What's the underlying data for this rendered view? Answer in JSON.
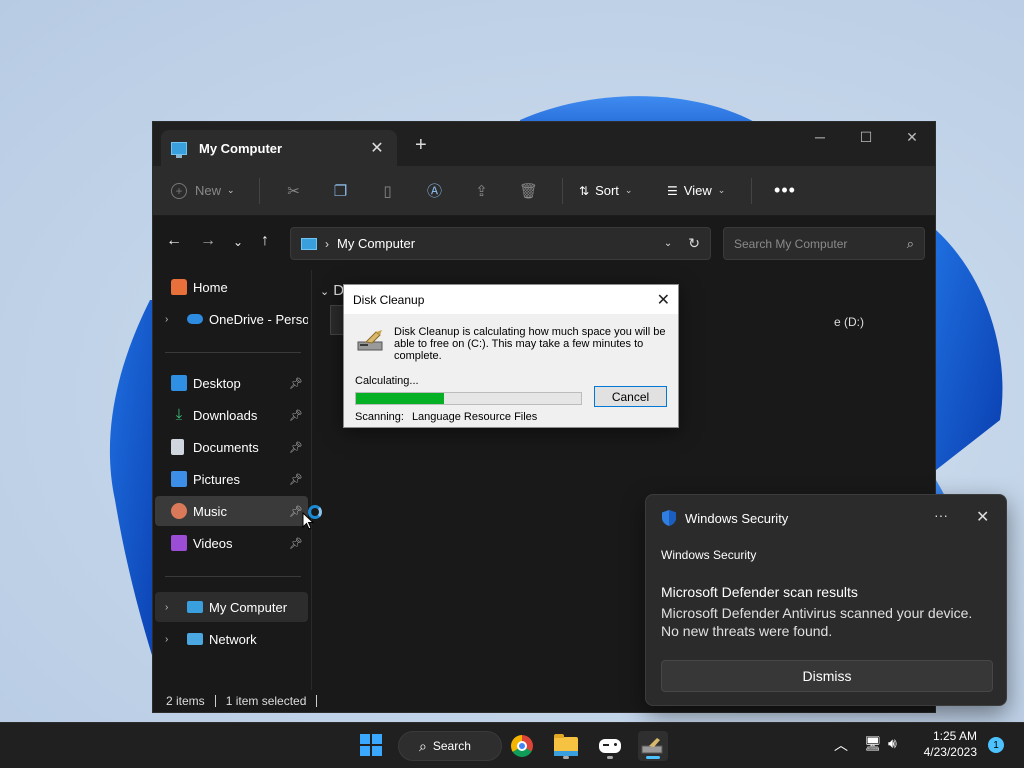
{
  "explorer": {
    "tab_title": "My Computer",
    "toolbar": {
      "new_label": "New",
      "sort_label": "Sort",
      "view_label": "View",
      "more_label": "•••"
    },
    "address": {
      "path": "My Computer",
      "search_placeholder": "Search My Computer"
    },
    "sidebar": {
      "items": [
        {
          "label": "Home"
        },
        {
          "label": "OneDrive - Persona"
        },
        {
          "label": "Desktop"
        },
        {
          "label": "Downloads"
        },
        {
          "label": "Documents"
        },
        {
          "label": "Pictures"
        },
        {
          "label": "Music"
        },
        {
          "label": "Videos"
        },
        {
          "label": "My Computer"
        },
        {
          "label": "Network"
        }
      ]
    },
    "content": {
      "group_header": "D",
      "drive_label": "e (D:)"
    },
    "status": {
      "items": "2 items",
      "selected": "1 item selected"
    }
  },
  "disk_cleanup": {
    "title": "Disk Cleanup",
    "message": "Disk Cleanup is calculating how much space you will be able to free on  (C:). This may take a few minutes to complete.",
    "calculating_label": "Calculating...",
    "progress": 0.39,
    "cancel_label": "Cancel",
    "scanning_label": "Scanning:",
    "scanning_value": "Language Resource Files"
  },
  "notification": {
    "app_name": "Windows Security",
    "source": "Windows Security",
    "title": "Microsoft Defender scan results",
    "body": "Microsoft Defender Antivirus scanned your device. No new threats were found.",
    "more_label": "···",
    "dismiss_label": "Dismiss"
  },
  "taskbar": {
    "search_label": "Search",
    "time": "1:25 AM",
    "date": "4/23/2023",
    "notification_count": "1"
  },
  "colors": {
    "accent": "#0078d7",
    "progress_fill": "#06b025",
    "taskbar_highlight": "#4cc2ff"
  }
}
